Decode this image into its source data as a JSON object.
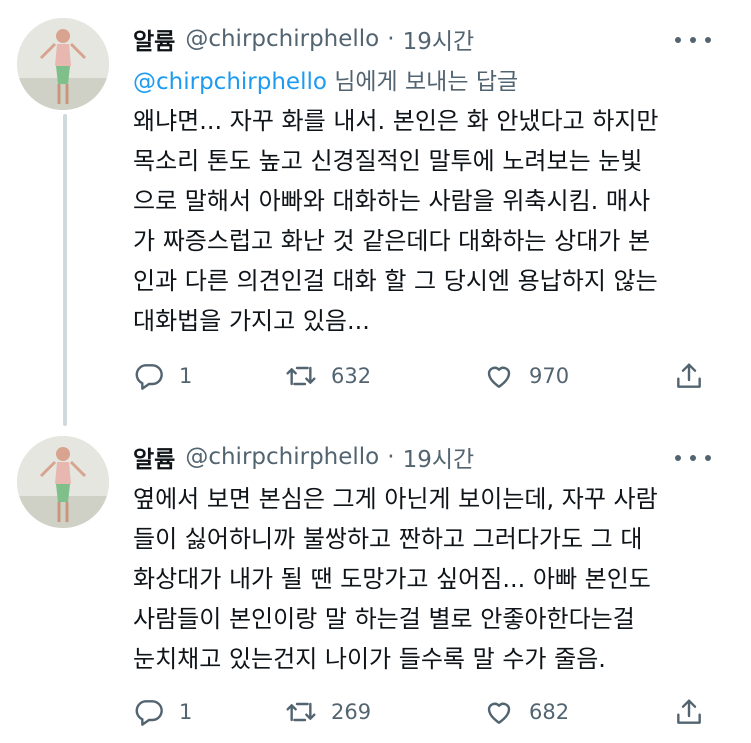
{
  "tweets": [
    {
      "name": "알륨",
      "handle": "@chirpchirphello",
      "dot": "·",
      "time": "19시간",
      "replying_to": {
        "mention": "@chirpchirphello",
        "suffix": " 님에게 보내는 답글"
      },
      "text_lines": [
        "왜냐면... 자꾸 화를 내서. 본인은 화 안냈다고 하지만",
        "목소리 톤도 높고 신경질적인 말투에 노려보는 눈빛",
        "으로 말해서 아빠와 대화하는 사람을 위축시킴. 매사",
        "가 짜증스럽고 화난 것 같은데다 대화하는 상대가 본",
        "인과 다른 의견인걸 대화 할 그 당시엔 용납하지 않는",
        "대화법을 가지고 있음..."
      ],
      "replies": "1",
      "retweets": "632",
      "likes": "970"
    },
    {
      "name": "알륨",
      "handle": "@chirpchirphello",
      "dot": "·",
      "time": "19시간",
      "text_lines": [
        "옆에서 보면 본심은 그게 아닌게 보이는데, 자꾸 사람",
        "들이 싫어하니까 불쌍하고 짠하고 그러다가도 그 대",
        "화상대가 내가 될 땐 도망가고 싶어짐... 아빠 본인도",
        "사람들이 본인이랑 말 하는걸 별로 안좋아한다는걸",
        "눈치채고 있는건지 나이가 들수록 말 수가 줄음."
      ],
      "replies": "1",
      "retweets": "269",
      "likes": "682"
    }
  ],
  "icons": {
    "reply": "reply-icon",
    "retweet": "retweet-icon",
    "like": "heart-icon",
    "share": "share-icon",
    "more": "more-icon"
  },
  "colors": {
    "text": "#0f1419",
    "secondary": "#536471",
    "link": "#1d9bf0",
    "thread_line": "#cfd9de"
  }
}
